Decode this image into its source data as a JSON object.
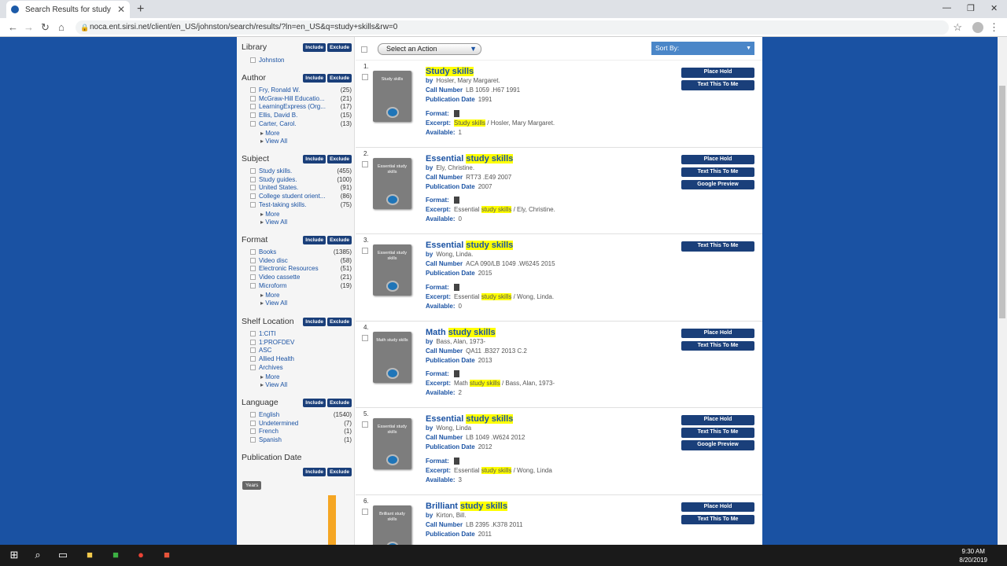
{
  "browser": {
    "tab_title": "Search Results for study skills",
    "tab_close": "✕",
    "new_tab": "+",
    "url": "noca.ent.sirsi.net/client/en_US/johnston/search/results/?ln=en_US&q=study+skills&rw=0",
    "back": "←",
    "forward": "→",
    "reload": "↻",
    "home": "⌂",
    "star": "☆",
    "menu": "⋮",
    "minimize": "—",
    "maximize": "❐",
    "close": "✕"
  },
  "facets": {
    "include": "Include",
    "exclude": "Exclude",
    "more": "More",
    "view_all": "View All",
    "library": {
      "title": "Library",
      "items": [
        {
          "name": "Johnston",
          "count": ""
        }
      ]
    },
    "author": {
      "title": "Author",
      "items": [
        {
          "name": "Fry, Ronald W.",
          "count": "(25)"
        },
        {
          "name": "McGraw-Hill Educatio...",
          "count": "(21)"
        },
        {
          "name": "LearningExpress (Org...",
          "count": "(17)"
        },
        {
          "name": "Ellis, David B.",
          "count": "(15)"
        },
        {
          "name": "Carter, Carol.",
          "count": "(13)"
        }
      ]
    },
    "subject": {
      "title": "Subject",
      "items": [
        {
          "name": "Study skills.",
          "count": "(455)"
        },
        {
          "name": "Study guides.",
          "count": "(100)"
        },
        {
          "name": "United States.",
          "count": "(91)"
        },
        {
          "name": "College student orient...",
          "count": "(86)"
        },
        {
          "name": "Test-taking skills.",
          "count": "(75)"
        }
      ]
    },
    "format": {
      "title": "Format",
      "items": [
        {
          "name": "Books",
          "count": "(1385)"
        },
        {
          "name": "Video disc",
          "count": "(58)"
        },
        {
          "name": "Electronic Resources",
          "count": "(51)"
        },
        {
          "name": "Video cassette",
          "count": "(21)"
        },
        {
          "name": "Microform",
          "count": "(19)"
        }
      ]
    },
    "shelf": {
      "title": "Shelf Location",
      "items": [
        {
          "name": "1:CITI",
          "count": ""
        },
        {
          "name": "1:PROFDEV",
          "count": ""
        },
        {
          "name": "ASC",
          "count": ""
        },
        {
          "name": "Allied Health",
          "count": ""
        },
        {
          "name": "Archives",
          "count": ""
        }
      ]
    },
    "language": {
      "title": "Language",
      "items": [
        {
          "name": "English",
          "count": "(1540)"
        },
        {
          "name": "Undetermined",
          "count": "(7)"
        },
        {
          "name": "French",
          "count": "(1)"
        },
        {
          "name": "Spanish",
          "count": "(1)"
        }
      ]
    },
    "pubdate": {
      "title": "Publication Date",
      "years_label": "Years"
    }
  },
  "toolbar": {
    "select_action": "Select an Action",
    "sort_by": "Sort By:"
  },
  "labels": {
    "by": "by",
    "call_number": "Call Number",
    "pub_date": "Publication Date",
    "format": "Format:",
    "excerpt": "Excerpt:",
    "available": "Available:",
    "place_hold": "Place Hold",
    "text_this": "Text This To Me",
    "google_preview": "Google Preview"
  },
  "results": [
    {
      "num": "1.",
      "title_pre": "",
      "title_hl": "Study skills",
      "cover": "Study skills",
      "author": "Hosler, Mary Margaret.",
      "call": "LB 1059 .H67 1991",
      "date": "1991",
      "ex_pre": "",
      "ex_hl": "Study skills",
      "ex_post": " / Hosler, Mary Margaret.",
      "avail": "1",
      "hold": true,
      "preview": false
    },
    {
      "num": "2.",
      "title_pre": "Essential ",
      "title_hl": "study skills",
      "cover": "Essential study skills",
      "author": "Ely, Christine.",
      "call": "RT73 .E49 2007",
      "date": "2007",
      "ex_pre": "Essential ",
      "ex_hl": "study skills",
      "ex_post": " / Ely, Christine.",
      "avail": "0",
      "hold": true,
      "preview": true
    },
    {
      "num": "3.",
      "title_pre": "Essential ",
      "title_hl": "study skills",
      "cover": "Essential study skills",
      "author": "Wong, Linda.",
      "call": "ACA 090/LB 1049 .W6245 2015",
      "date": "2015",
      "ex_pre": "Essential ",
      "ex_hl": "study skills",
      "ex_post": " / Wong, Linda.",
      "avail": "0",
      "hold": false,
      "preview": false
    },
    {
      "num": "4.",
      "title_pre": "Math ",
      "title_hl": "study skills",
      "cover": "Math study skills",
      "author": "Bass, Alan, 1973-",
      "call": "QA11 .B327 2013 C.2",
      "date": "2013",
      "ex_pre": "Math ",
      "ex_hl": "study skills",
      "ex_post": " / Bass, Alan, 1973-",
      "avail": "2",
      "hold": true,
      "preview": false
    },
    {
      "num": "5.",
      "title_pre": "Essential ",
      "title_hl": "study skills",
      "cover": "Essential study skills",
      "author": "Wong, Linda",
      "call": "LB 1049 .W624 2012",
      "date": "2012",
      "ex_pre": "Essential ",
      "ex_hl": "study skills",
      "ex_post": " / Wong, Linda",
      "avail": "3",
      "hold": true,
      "preview": true
    },
    {
      "num": "6.",
      "title_pre": "Brilliant ",
      "title_hl": "study skills",
      "cover": "Brilliant study skills",
      "author": "Kirton, Bill.",
      "call": "LB 2395 .K378 2011",
      "date": "2011",
      "ex_pre": "",
      "ex_hl": "",
      "ex_post": "",
      "avail": "",
      "hold": true,
      "preview": false
    }
  ],
  "taskbar": {
    "time": "9:30 AM",
    "date": "8/20/2019"
  }
}
